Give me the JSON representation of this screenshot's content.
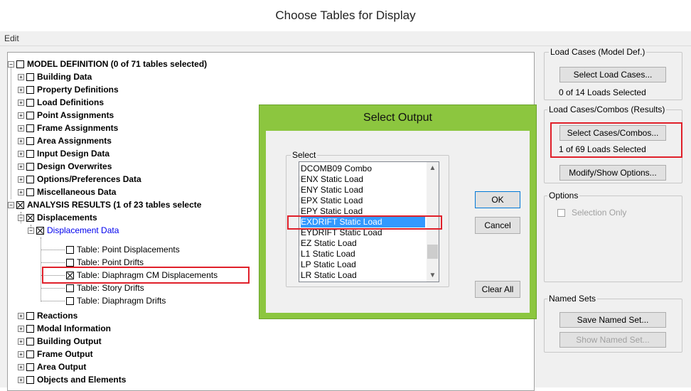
{
  "window": {
    "title": "Choose Tables for Display"
  },
  "menu": {
    "edit": "Edit"
  },
  "tree": {
    "model_definition": "MODEL DEFINITION  (0 of 71 tables selected)",
    "building_data": "Building Data",
    "property_definitions": "Property Definitions",
    "load_definitions": "Load Definitions",
    "point_assignments": "Point Assignments",
    "frame_assignments": "Frame Assignments",
    "area_assignments": "Area Assignments",
    "input_design_data": "Input Design Data",
    "design_overwrites": "Design Overwrites",
    "options_preferences": "Options/Preferences Data",
    "misc_data": "Miscellaneous Data",
    "analysis_results": "ANALYSIS RESULTS  (1 of 23 tables selecte",
    "displacements": "Displacements",
    "displacement_data": "Displacement Data",
    "point_displacements": "Table:  Point Displacements",
    "point_drifts": "Table:  Point Drifts",
    "diaphragm_cm": "Table:  Diaphragm CM Displacements",
    "story_drifts": "Table:  Story Drifts",
    "diaphragm_drifts": "Table:  Diaphragm Drifts",
    "reactions": "Reactions",
    "modal_information": "Modal Information",
    "building_output": "Building Output",
    "frame_output": "Frame Output",
    "area_output": "Area Output",
    "objects_elements": "Objects and Elements"
  },
  "right_panel": {
    "load_cases_model_title": "Load Cases (Model Def.)",
    "select_load_cases": "Select Load Cases...",
    "loads_selected_model": "0  of  14  Loads Selected",
    "load_cases_results_title": "Load Cases/Combos (Results)",
    "select_cases_combos": "Select Cases/Combos...",
    "loads_selected_results": "1  of  69  Loads Selected",
    "modify_show_options": "Modify/Show Options...",
    "options_title": "Options",
    "selection_only": "Selection Only",
    "named_sets_title": "Named Sets",
    "save_named_set": "Save Named Set...",
    "show_named_set": "Show Named Set..."
  },
  "dialog": {
    "title": "Select Output",
    "select_group": "Select",
    "items": [
      "DCOMB09 Combo",
      "ENX Static Load",
      "ENY Static Load",
      "EPX Static Load",
      "EPY Static Load",
      "EXDRIFT Static Load",
      "EYDRIFT Static Load",
      "EZ Static Load",
      "L1 Static Load",
      "LP Static Load",
      "LR Static Load"
    ],
    "selected_index": 5,
    "ok": "OK",
    "cancel": "Cancel",
    "clear_all": "Clear All"
  },
  "colors": {
    "dialog_frame": "#8cc63f",
    "highlight": "#e0202a",
    "selection": "#3399ff",
    "link": "#0000ee"
  }
}
